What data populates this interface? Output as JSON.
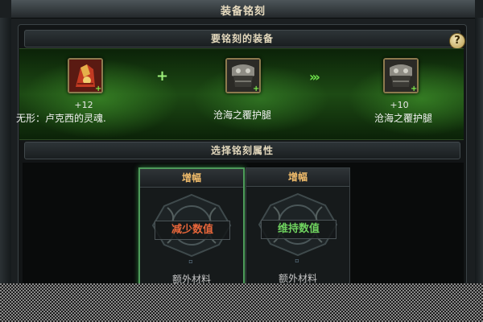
{
  "window": {
    "title": "装备铭刻",
    "close_glyph": "×"
  },
  "section_equipment": {
    "title": "要铭刻的装备",
    "help_glyph": "?"
  },
  "slots": {
    "source": {
      "enhance": "+12",
      "name": "无形：卢克西的灵魂.",
      "icon": "red-armor-icon"
    },
    "plus_symbol": "+",
    "material": {
      "name": "沧海之覆护腿",
      "icon": "armored-leg-icon"
    },
    "arrow_symbol": "›››",
    "result": {
      "enhance": "+10",
      "name": "沧海之覆护腿",
      "icon": "armored-leg-icon"
    }
  },
  "section_attribute": {
    "title": "选择铭刻属性"
  },
  "options": [
    {
      "header": "增幅",
      "label": "减少数值",
      "sub": "额外材料",
      "small": "▫"
    },
    {
      "header": "增幅",
      "label": "维持数值",
      "sub": "额外材料",
      "small": "▫"
    }
  ],
  "colors": {
    "accent_green": "#6ee04a",
    "reduce_red": "#e8663a",
    "keep_green": "#6fd35f",
    "header_gold": "#eeba6a"
  }
}
